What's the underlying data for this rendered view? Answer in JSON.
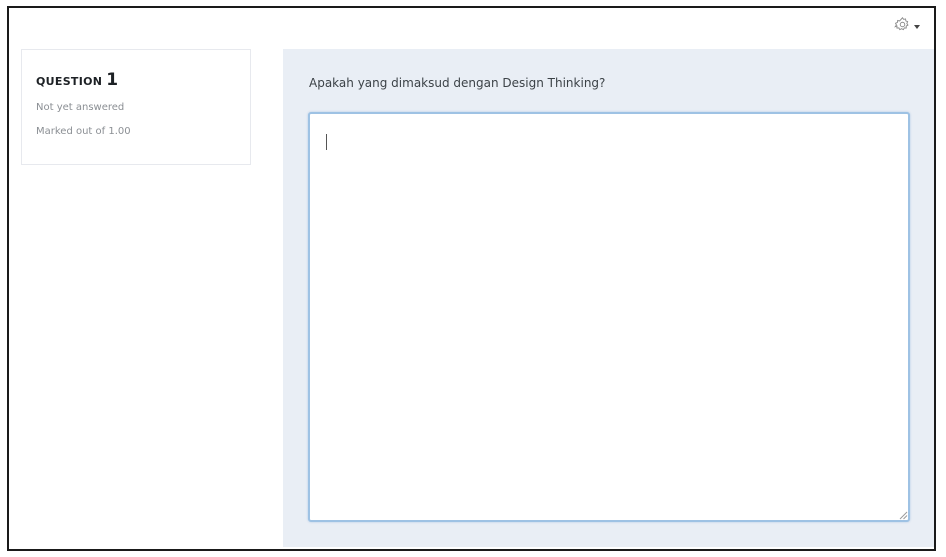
{
  "toolbar": {
    "settings_icon": "gear-icon",
    "menu_caret_icon": "caret-down-icon"
  },
  "question_info": {
    "label": "QUESTION",
    "number": "1",
    "status": "Not yet answered",
    "marks": "Marked out of 1.00"
  },
  "question": {
    "text": "Apakah yang dimaksud dengan Design Thinking?",
    "answer_value": "",
    "answer_placeholder": ""
  },
  "colors": {
    "content_background": "#e9eef5",
    "focus_border": "#9ec2e4",
    "frame_border": "#1a1a1a"
  }
}
